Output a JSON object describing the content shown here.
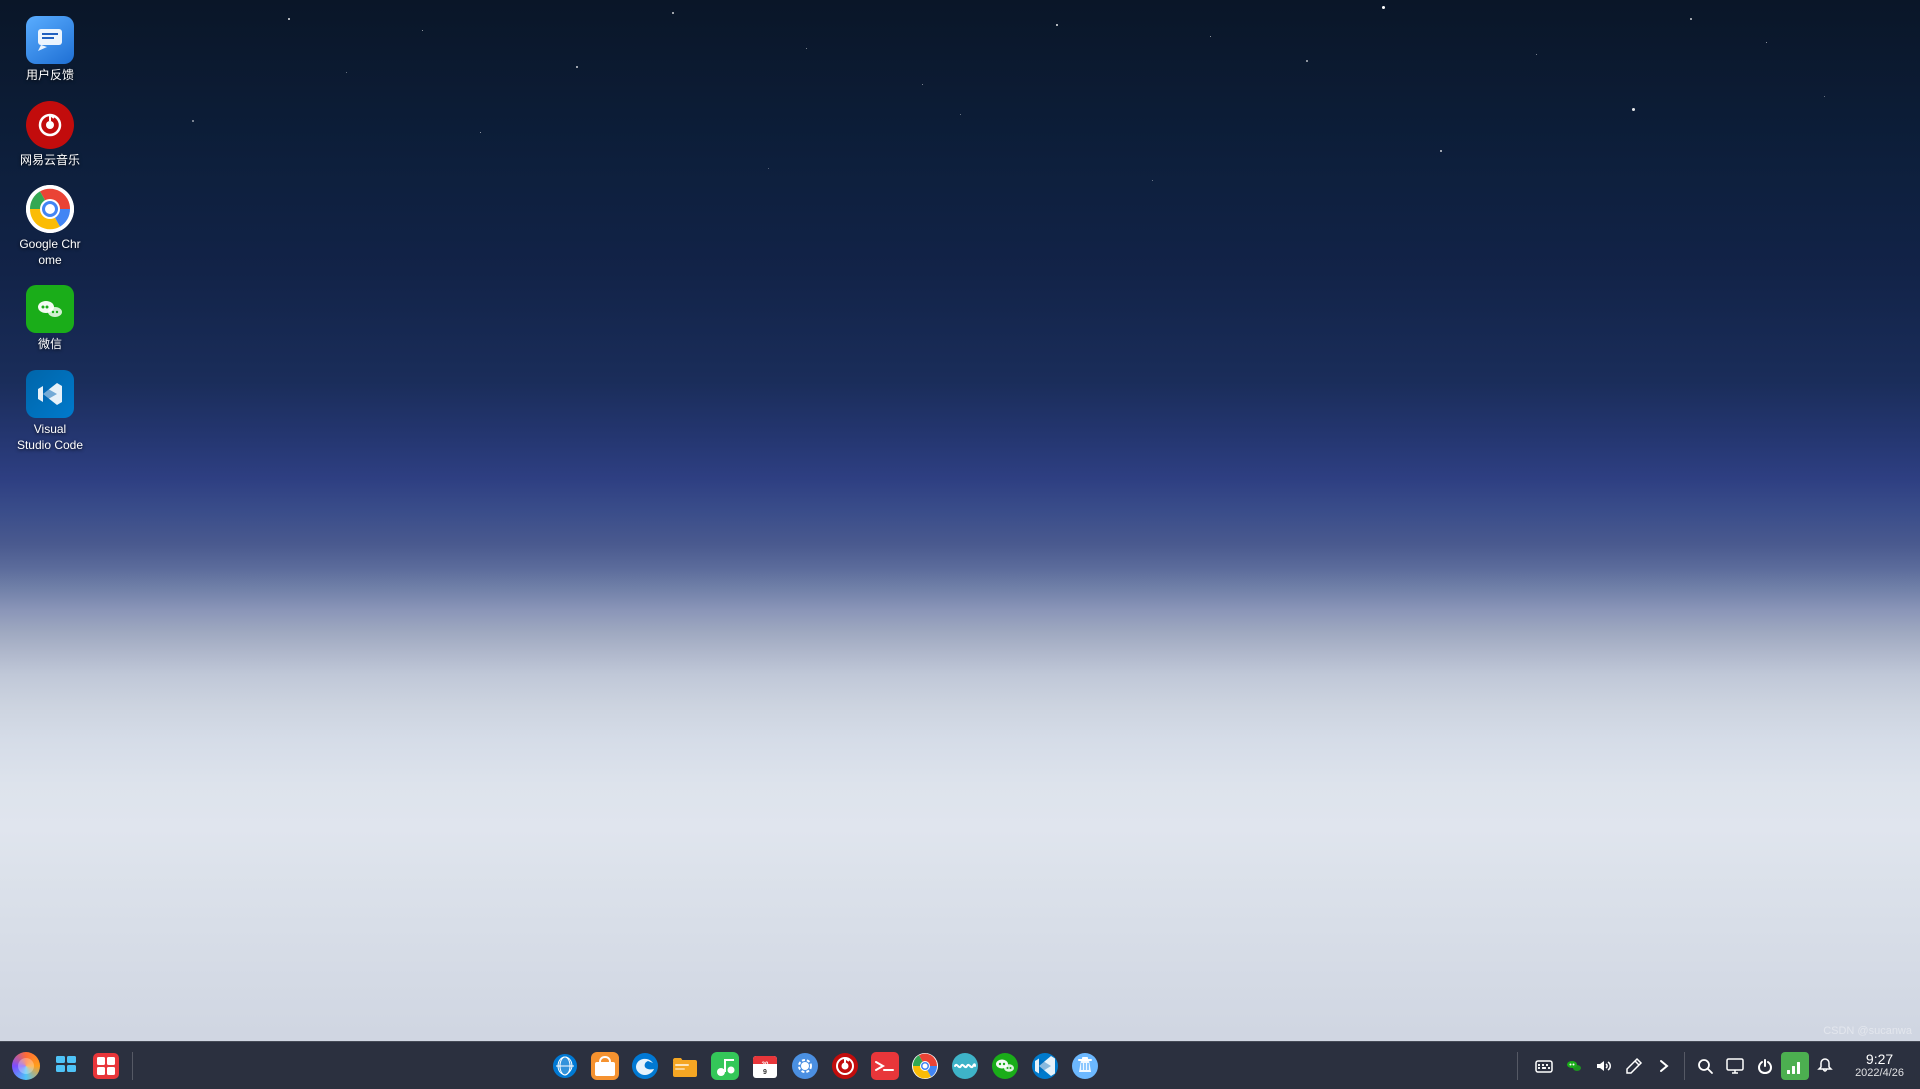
{
  "desktop": {
    "background_description": "Night sky with stars transitioning to sand dunes",
    "icons": [
      {
        "id": "user-feedback",
        "label": "用户反馈",
        "icon_type": "feedback",
        "icon_color": "#4a9eff"
      },
      {
        "id": "netease-music",
        "label": "网易云音乐",
        "icon_type": "netease",
        "icon_color": "#c20c0c"
      },
      {
        "id": "google-chrome",
        "label": "Google Chrome",
        "icon_type": "chrome",
        "icon_color": "#ffffff"
      },
      {
        "id": "wechat",
        "label": "微信",
        "icon_type": "wechat",
        "icon_color": "#1aad19"
      },
      {
        "id": "vscode",
        "label": "Visual Studio Code",
        "icon_type": "vscode",
        "icon_color": "#0066b8"
      }
    ]
  },
  "taskbar": {
    "left_icons": [
      {
        "id": "launcher",
        "label": "启动器",
        "symbol": "⬡"
      },
      {
        "id": "multitask",
        "label": "多任务",
        "symbol": "▦"
      },
      {
        "id": "store",
        "label": "应用商店",
        "symbol": "🏪"
      }
    ],
    "center_icons": [
      {
        "id": "deepin-browser",
        "label": "浏览器",
        "symbol": "🌊"
      },
      {
        "id": "app-store2",
        "label": "商店",
        "symbol": "🛍"
      },
      {
        "id": "edge",
        "label": "Edge",
        "symbol": "🌀"
      },
      {
        "id": "files",
        "label": "文件管理器",
        "symbol": "🗂"
      },
      {
        "id": "music",
        "label": "音乐",
        "symbol": "🎵"
      },
      {
        "id": "calendar",
        "label": "日历",
        "symbol": "📅"
      },
      {
        "id": "settings",
        "label": "系统设置",
        "symbol": "⚙"
      },
      {
        "id": "netease2",
        "label": "网易云音乐",
        "symbol": "🎵"
      },
      {
        "id": "terminal",
        "label": "终端",
        "symbol": "⬛"
      },
      {
        "id": "chrome2",
        "label": "Chrome",
        "symbol": "◎"
      },
      {
        "id": "deepin-music2",
        "label": "应用",
        "symbol": "〜"
      },
      {
        "id": "wechat2",
        "label": "微信",
        "symbol": "💬"
      },
      {
        "id": "vscode2",
        "label": "VSCode",
        "symbol": "❮"
      },
      {
        "id": "recycle",
        "label": "回收站",
        "symbol": "🔄"
      }
    ],
    "right_icons": [
      {
        "id": "keyboard",
        "label": "键盘",
        "symbol": "⌨"
      },
      {
        "id": "wechat-tray",
        "label": "微信",
        "symbol": "💬"
      },
      {
        "id": "volume",
        "label": "音量",
        "symbol": "🔊"
      },
      {
        "id": "pen",
        "label": "画笔",
        "symbol": "✏"
      },
      {
        "id": "arrow",
        "label": "箭头",
        "symbol": "▶"
      },
      {
        "id": "search",
        "label": "搜索",
        "symbol": "🔍"
      },
      {
        "id": "screen",
        "label": "屏幕",
        "symbol": "🖥"
      },
      {
        "id": "power",
        "label": "电源",
        "symbol": "⏻"
      },
      {
        "id": "network",
        "label": "网络",
        "symbol": "📶"
      },
      {
        "id": "notification",
        "label": "通知",
        "symbol": "🔔"
      }
    ]
  },
  "clock": {
    "time": "9:27",
    "date": "2022/4/26"
  },
  "watermark": {
    "text": "CSDN @sucanwa"
  }
}
